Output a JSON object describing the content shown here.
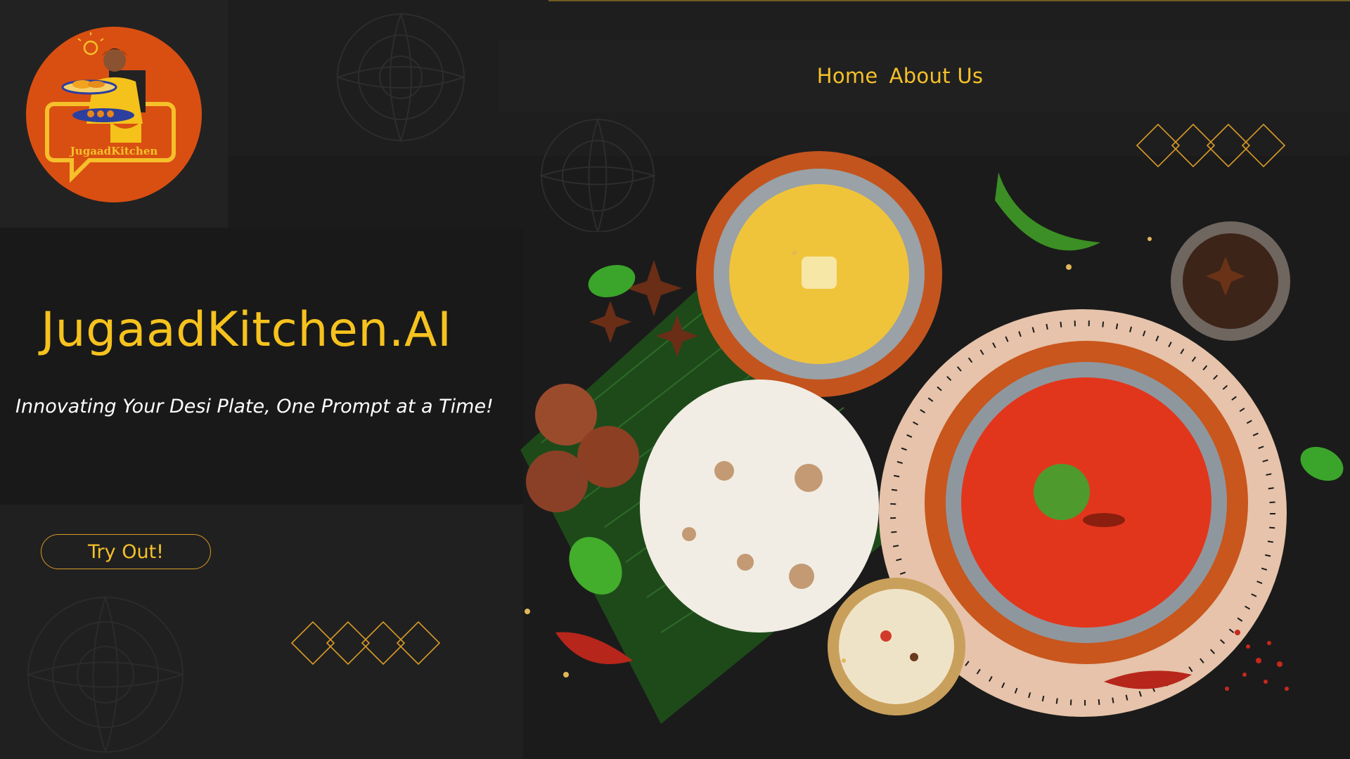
{
  "brand": {
    "logo_icon": "chef-woman-logo",
    "logo_text": "JugaadKitchen",
    "title": "JugaadKitchen.AI",
    "tagline": "Innovating Your Desi Plate, One Prompt at a Time!"
  },
  "nav": {
    "items": [
      {
        "label": "Home"
      },
      {
        "label": "About Us"
      }
    ]
  },
  "cta": {
    "label": "Try Out!"
  },
  "colors": {
    "accent": "#f5c02a",
    "background": "#1b1b1b",
    "logo_bg": "#d94f12"
  },
  "illustration": {
    "icon": "indian-thali-food-illustration"
  }
}
